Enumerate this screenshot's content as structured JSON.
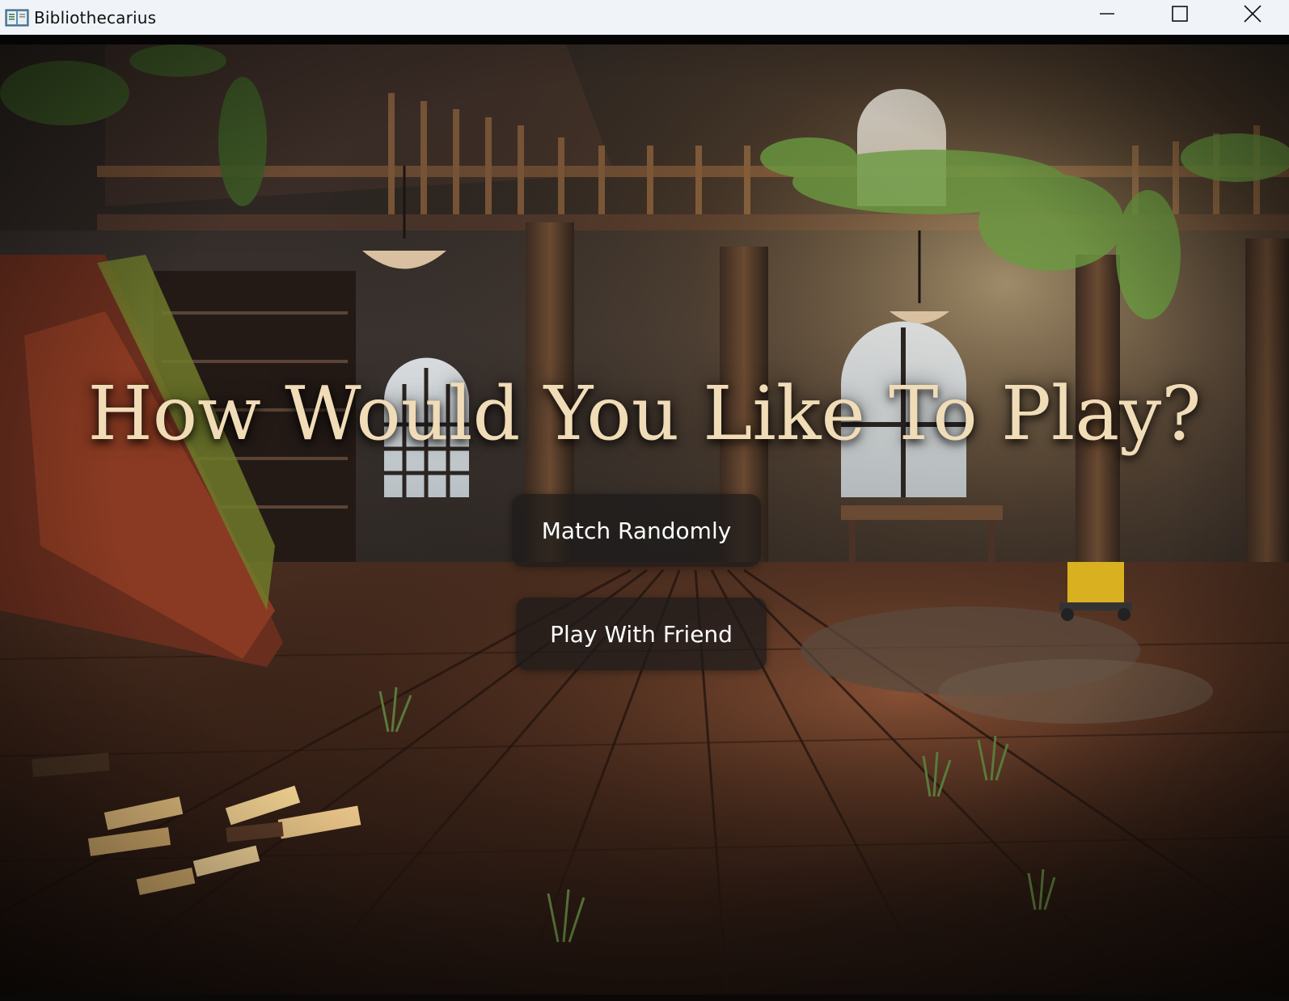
{
  "window": {
    "title": "Bibliothecarius",
    "icon": "library-book-icon",
    "controls": [
      "minimize-icon",
      "maximize-icon",
      "close-icon"
    ]
  },
  "main": {
    "heading": "How Would You Like To Play?",
    "buttons": {
      "match_randomly": "Match Randomly",
      "play_with_friend": "Play With Friend"
    }
  },
  "colors": {
    "heading": "#f1dcb8",
    "button_bg": "#1c1a1a",
    "button_text": "#ffffff",
    "titlebar_bg": "#f0f4f8"
  }
}
